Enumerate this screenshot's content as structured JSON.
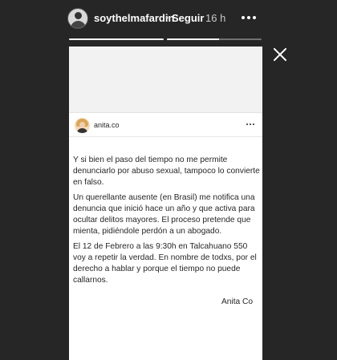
{
  "header": {
    "username": "soythelmafardin",
    "separator": "•",
    "follow_label": "Seguir",
    "time": "16 h",
    "more_icon": "more-horizontal-icon"
  },
  "progress": {
    "segments": [
      1,
      0.55
    ]
  },
  "close_icon": "close-icon",
  "post": {
    "username": "anita.co",
    "more_icon": "more-horizontal-icon",
    "paragraphs": [
      "Y si bien el paso del tiempo no me permite denunciarlo por abuso sexual, tampoco lo convierte en falso.",
      "Un querellante ausente (en Brasil) me notifica una denuncia que inició hace un año y que activa para ocultar delitos mayores. El proceso pretende que mienta, pidiéndole perdón a un abogado.",
      "El 12 de Febrero a las 9:30h en Talcahuano 550 voy a repetir la verdad. En nombre de todxs, por el derecho a hablar y porque el tiempo no puede callarnos."
    ],
    "signature": "Anita Co"
  }
}
